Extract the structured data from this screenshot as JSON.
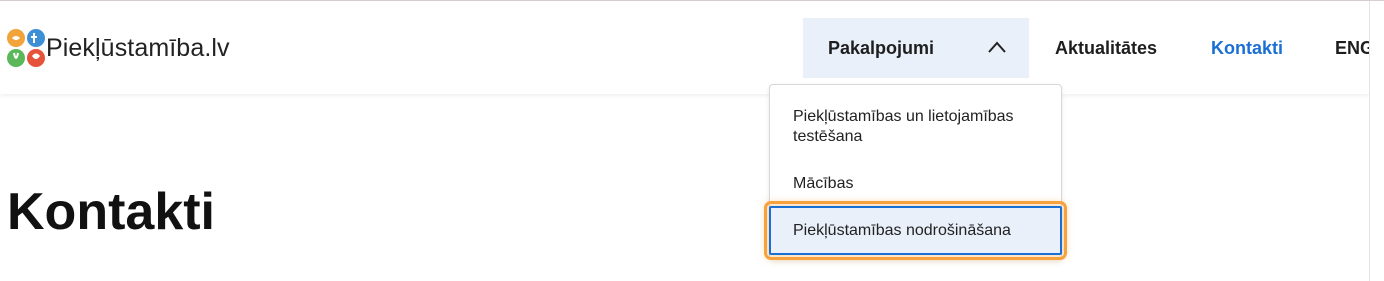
{
  "header": {
    "logo_text": "Piekļūstamība.lv",
    "nav": {
      "services_label": "Pakalpojumi",
      "news_label": "Aktualitātes",
      "contacts_label": "Kontakti",
      "lang_label": "ENG"
    }
  },
  "dropdown": {
    "items": [
      "Piekļūstamības un lietojamības testēšana",
      "Mācības",
      "Piekļūstamības nodrošināšana"
    ],
    "focused_index": 2
  },
  "main": {
    "title": "Kontakti"
  },
  "colors": {
    "accent": "#1a6fd4",
    "nav_active_bg": "#e9f0fa",
    "focus_ring": "#f7a23d"
  },
  "icons": {
    "services_toggle": "chevron-up-icon"
  }
}
